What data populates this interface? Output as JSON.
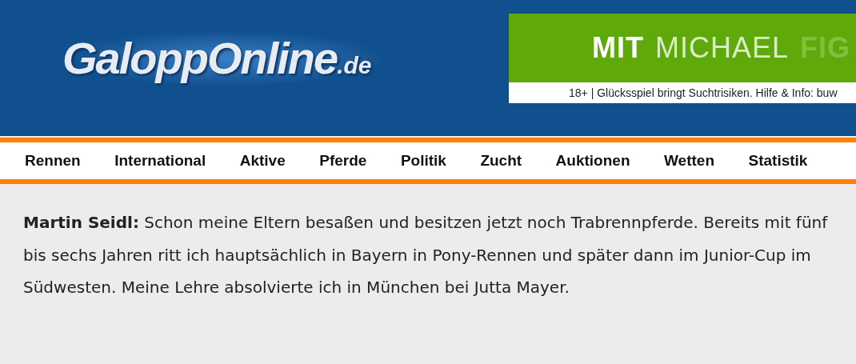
{
  "header": {
    "logo": {
      "name": "GaloppOnline",
      "suffix": ".de"
    },
    "ad": {
      "headline": [
        {
          "text": "MIT",
          "kind": "strong"
        },
        {
          "text": "MICHAEL",
          "kind": "light"
        },
        {
          "text": "FIG",
          "kind": "faded"
        }
      ],
      "disclaimer": "18+ |  Glücksspiel bringt Suchtrisiken. Hilfe & Info: buw"
    }
  },
  "nav": {
    "items": [
      "Rennen",
      "International",
      "Aktive",
      "Pferde",
      "Politik",
      "Zucht",
      "Auktionen",
      "Wetten",
      "Statistik"
    ]
  },
  "article": {
    "paragraph": "**Martin Seidl:** Schon meine Eltern besaßen und besitzen jetzt noch Trabrennpferde. Bereits mit fünf bis sechs Jahren ritt ich hauptsächlich in Bayern in Pony-Rennen und später dann im Junior-Cup im Südwesten. Meine Lehre absolvierte ich in München bei Jutta Mayer."
  }
}
